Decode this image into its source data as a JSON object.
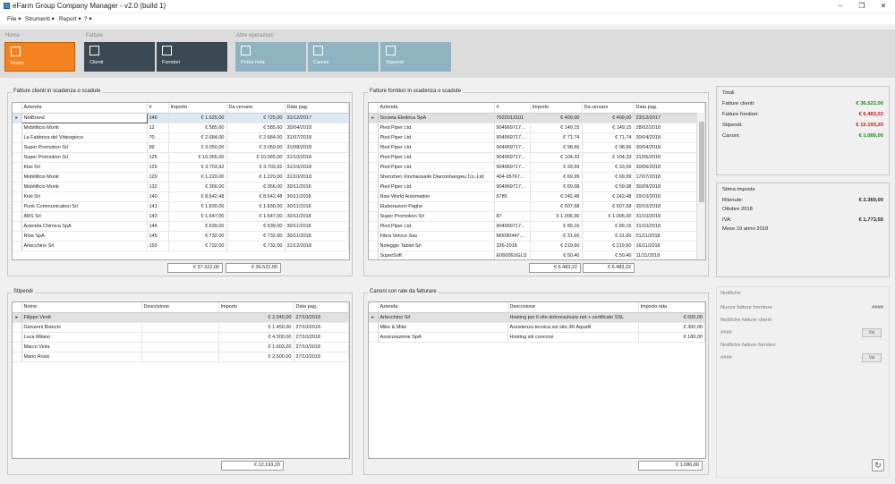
{
  "window": {
    "title": "eFarm Group Company Manager - v2.0 (build 1)"
  },
  "menu": [
    "File ▾",
    "Strumenti ▾",
    "Report ▾",
    "? ▾"
  ],
  "ribbon": {
    "groups": {
      "home": "Home",
      "fatture": "Fatture",
      "altre": "Altre operazioni"
    },
    "buttons": {
      "home": "Home",
      "clienti": "Clienti",
      "fornitori": "Fornitori",
      "prima_nota": "Prima nota",
      "canoni": "Canoni",
      "stipendi": "Stipendi"
    }
  },
  "fatture_clienti": {
    "title": "Fatture clienti in scadenza o scadute",
    "columns": [
      "Azienda",
      "#",
      "Importo",
      "Da versare",
      "Data pag."
    ],
    "rows": [
      [
        "NetBrand",
        "146",
        "€ 1.525,00",
        "€ 725,00",
        "31/12/2017"
      ],
      [
        "Mobilificio Monti",
        "12",
        "€ 585,60",
        "€ 585,60",
        "30/04/2018"
      ],
      [
        "La Fabbrica del Videogioco",
        "70",
        "€ 2.684,00",
        "€ 2.684,00",
        "31/07/2018"
      ],
      [
        "Super Promotion Srl",
        "99",
        "€ 3.050,00",
        "€ 3.050,00",
        "31/08/2018"
      ],
      [
        "Super Promotion Srl",
        "125",
        "€ 10.065,00",
        "€ 10.065,00",
        "31/10/2018"
      ],
      [
        "Kiwi Srl",
        "126",
        "€ 3.703,92",
        "€ 3.703,92",
        "31/10/2018"
      ],
      [
        "Mobilificio Monti",
        "129",
        "€ 1.220,00",
        "€ 1.220,00",
        "31/10/2018"
      ],
      [
        "Mobilificio Monti",
        "132",
        "€ 366,00",
        "€ 366,00",
        "30/11/2018"
      ],
      [
        "Kiwi Srl",
        "140",
        "€ 8.642,48",
        "€ 8.642,48",
        "30/11/2018"
      ],
      [
        "Punk Communication Srl",
        "141",
        "€ 1.830,00",
        "€ 1.830,00",
        "30/11/2018"
      ],
      [
        "ABS Srl",
        "143",
        "€ 1.647,00",
        "€ 1.647,00",
        "30/11/2018"
      ],
      [
        "Azienda Chimica SpA",
        "144",
        "€ 539,00",
        "€ 539,00",
        "30/11/2018"
      ],
      [
        "Rina SpA",
        "145",
        "€ 732,00",
        "€ 732,00",
        "30/11/2018"
      ],
      [
        "Arlecchino Srl",
        "159",
        "€ 732,00",
        "€ 732,00",
        "31/12/2018"
      ]
    ],
    "total_importo": "€ 37.322,00",
    "total_versare": "€ 36.522,00"
  },
  "fatture_fornitori": {
    "title": "Fatture fornitori in scadenza o scadute",
    "columns": [
      "Azienda",
      "#",
      "Importo",
      "Da versare",
      "Data pag."
    ],
    "rows": [
      [
        "Societa Elettrica SpA",
        "7022013101",
        "€ 409,00",
        "€ 409,00",
        "23/12/2017"
      ],
      [
        "Pied Piper Ltd.",
        "904969717...",
        "€ 149,15",
        "€ 149,15",
        "28/02/2018"
      ],
      [
        "Pied Piper Ltd.",
        "904969717...",
        "€ 71,74",
        "€ 71,74",
        "30/04/2018"
      ],
      [
        "Pied Piper Ltd.",
        "904969717...",
        "€ 98,66",
        "€ 98,66",
        "30/04/2018"
      ],
      [
        "Pied Piper Ltd.",
        "904969717...",
        "€ 104,33",
        "€ 104,33",
        "31/05/2018"
      ],
      [
        "Pied Piper Ltd.",
        "904969717...",
        "€ 33,59",
        "€ 33,59",
        "30/06/2018"
      ],
      [
        "Shenzhen Xinchaosaite Dianzishangwu Co.,Ltd",
        "404-95767...",
        "€ 69,99",
        "€ 69,99",
        "17/07/2018"
      ],
      [
        "Pied Piper Ltd.",
        "904969717...",
        "€ 59,08",
        "€ 59,08",
        "30/09/2018"
      ],
      [
        "New World Automation",
        "6785",
        "€ 242,48",
        "€ 242,48",
        "29/10/2018"
      ],
      [
        "Elaborazioni Paghe",
        "",
        "€ 507,68",
        "€ 507,68",
        "30/10/2018"
      ],
      [
        "Super Promotion Srl",
        "87",
        "€ 1.006,30",
        "€ 1.006,30",
        "31/10/2018"
      ],
      [
        "Pied Piper Ltd.",
        "904969717...",
        "€ 89,16",
        "€ 89,16",
        "31/10/2018"
      ],
      [
        "Fibra Veloce Sas",
        "M0090447...",
        "€ 31,60",
        "€ 31,60",
        "01/11/2018"
      ],
      [
        "Noleggio Tablet Srl",
        "336-2018",
        "€ 219,60",
        "€ 219,60",
        "16/11/2018"
      ],
      [
        "SuperSoft",
        "E06006UGLS",
        "€ 50,40",
        "€ 50,40",
        "11/11/2018"
      ]
    ],
    "total_importo": "€ 6.483,22",
    "total_versare": "€ 6.483,22"
  },
  "stipendi": {
    "title": "Stipendi",
    "columns": [
      "Nome",
      "Descrizione",
      "Importo",
      "Data pag."
    ],
    "rows": [
      [
        "Filippo Verdi",
        "",
        "€ 2.340,00",
        "27/10/2018"
      ],
      [
        "Giovanni Bianchi",
        "",
        "€ 1.450,00",
        "27/10/2018"
      ],
      [
        "Luca Milano",
        "",
        "€ 4.300,00",
        "27/10/2018"
      ],
      [
        "Marco Viola",
        "",
        "€ 1.603,20",
        "27/10/2018"
      ],
      [
        "Mario Rossi",
        "",
        "€ 2.500,00",
        "27/10/2018"
      ]
    ],
    "total": "€ 12.193,20"
  },
  "canoni": {
    "title": "Canoni con rate da fatturare",
    "columns": [
      "Azienda",
      "Descrizione",
      "Importo rata"
    ],
    "rows": [
      [
        "Arlecchino Srl",
        "Hosting per il sito dolorevulvare.net + certificato SSL",
        "€ 600,00"
      ],
      [
        "Mike & Mike",
        "Assistenza tecnica sul sito 3R Aquafil",
        "€ 300,00"
      ],
      [
        "Assicurazione SpA",
        "Hosting siti concorsi",
        "€ 180,00"
      ]
    ],
    "total": "€ 1.080,00"
  },
  "totali": {
    "title": "Totali",
    "rows": [
      {
        "label": "Fatture clienti:",
        "value": "€ 36.522,00",
        "color": "#1a8a1a"
      },
      {
        "label": "Fatture fornitori:",
        "value": "€ 6.483,22",
        "color": "#cc1111"
      },
      {
        "label": "Stipendi:",
        "value": "€ 12.193,20",
        "color": "#cc1111"
      },
      {
        "label": "Canoni:",
        "value": "€ 1.080,00",
        "color": "#1a8a1a"
      }
    ]
  },
  "stima_imposte": {
    "title": "Stima imposte",
    "ritenute_label": "Ritenute:",
    "ritenute_value": "€ 2.360,00",
    "ritenute_period": "Ottobre 2018",
    "iva_label": "IVA:",
    "iva_value": "€ 1.773,55",
    "iva_period": "Mese 10 anno 2018"
  },
  "notifiche": {
    "title": "Notifiche",
    "nuove_label": "Nuove fatture fornitore",
    "nuove_value": "####",
    "clienti_label": "Notifiche fatture clienti",
    "clienti_value": "####",
    "clienti_btn": "Vai",
    "fornitori_label": "Notifiche fatture fornitori",
    "fornitori_value": "####",
    "fornitori_btn": "Vai"
  }
}
